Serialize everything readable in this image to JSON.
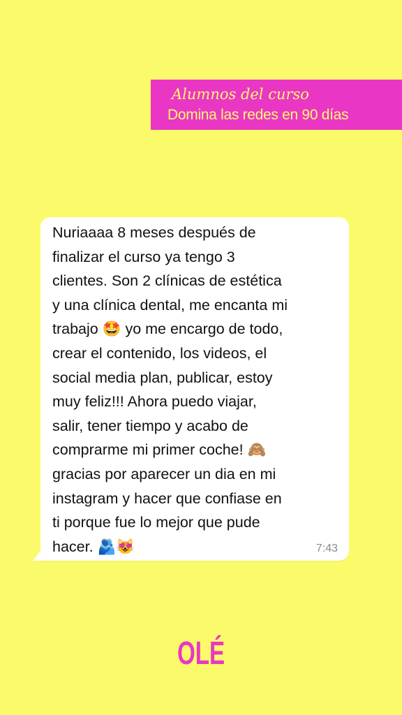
{
  "banner": {
    "kicker": "Alumnos del curso",
    "course_name": "Domina las redes en 90 días"
  },
  "message": {
    "text": "Nuriaaaa 8 meses después de\nfinalizar el curso ya tengo 3\nclientes. Son 2 clínicas de estética\ny una clínica dental, me encanta mi\ntrabajo 🤩 yo me encargo de todo,\ncrear el contenido, los videos, el\nsocial media plan, publicar, estoy\nmuy feliz!!! Ahora puedo viajar,\nsalir, tener tiempo y acabo de\ncomprarme mi primer coche! 🙈\ngracias por aparecer un dia en mi\ninstagram y hacer que confiase en\nti porque fue lo mejor que pude\nhacer. 🫂😻",
    "time": "7:43"
  },
  "brand": {
    "logo_text": "OLÉ"
  },
  "colors": {
    "background": "#fbfa6a",
    "accent": "#ea36c5",
    "bubble": "#ffffff"
  }
}
